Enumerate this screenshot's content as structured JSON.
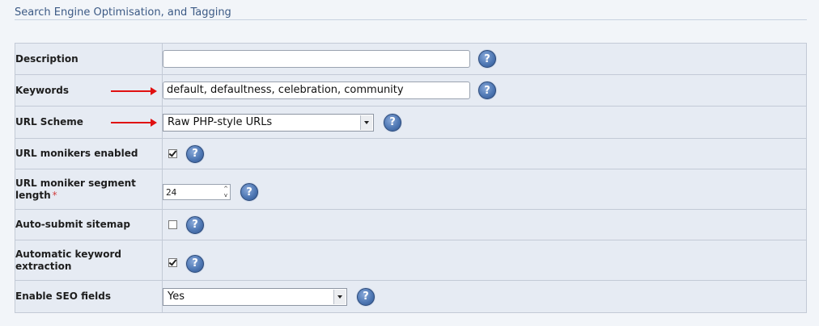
{
  "section": {
    "title": "Search Engine Optimisation, and Tagging"
  },
  "rows": {
    "description": {
      "label": "Description",
      "value": ""
    },
    "keywords": {
      "label": "Keywords",
      "value": "default, defaultness, celebration, community"
    },
    "url_scheme": {
      "label": "URL Scheme",
      "value": "Raw PHP-style URLs"
    },
    "url_monikers": {
      "label": "URL monikers enabled",
      "checked": true
    },
    "moniker_length": {
      "label": "URL moniker segment length",
      "required_mark": "*",
      "value": "24"
    },
    "auto_sitemap": {
      "label": "Auto-submit sitemap",
      "checked": false
    },
    "auto_keyword": {
      "label": "Automatic keyword extraction",
      "checked": true
    },
    "seo_fields": {
      "label": "Enable SEO fields",
      "value": "Yes"
    }
  },
  "help_glyph": "?",
  "icons": [
    "help-icon",
    "checkbox-icon",
    "dropdown-arrow-icon",
    "red-arrow-icon"
  ],
  "colors": {
    "accent_arrow": "#e01010",
    "help_button": "#4f78b4",
    "title": "#3c5a85"
  }
}
